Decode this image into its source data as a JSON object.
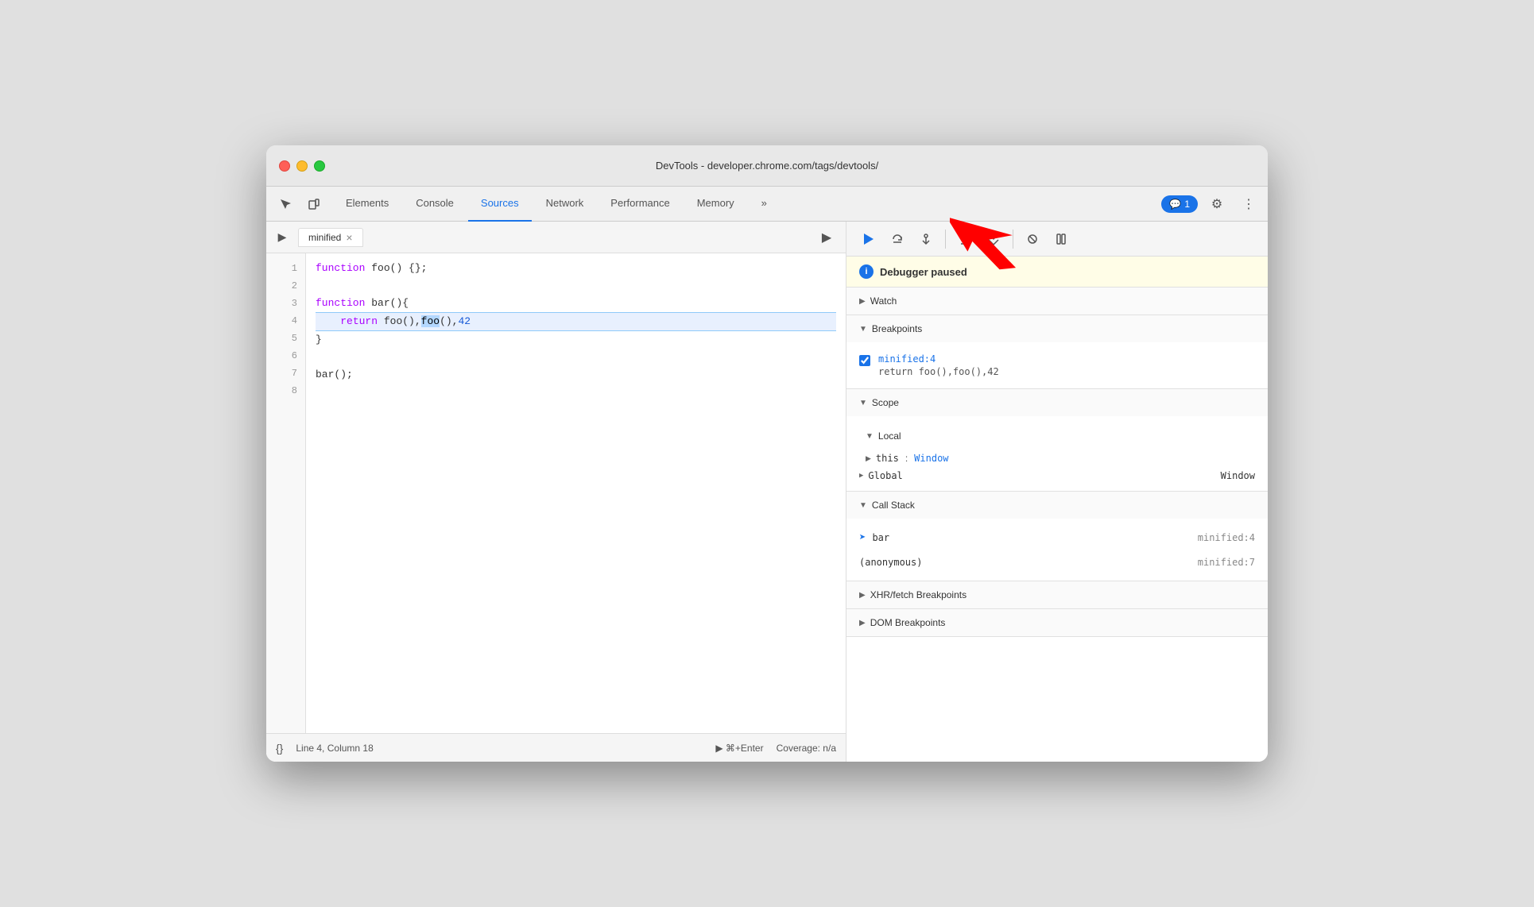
{
  "window": {
    "title": "DevTools - developer.chrome.com/tags/devtools/"
  },
  "toolbar": {
    "tabs": [
      {
        "id": "elements",
        "label": "Elements",
        "active": false
      },
      {
        "id": "console",
        "label": "Console",
        "active": false
      },
      {
        "id": "sources",
        "label": "Sources",
        "active": true
      },
      {
        "id": "network",
        "label": "Network",
        "active": false
      },
      {
        "id": "performance",
        "label": "Performance",
        "active": false
      },
      {
        "id": "memory",
        "label": "Memory",
        "active": false
      },
      {
        "id": "more",
        "label": "»",
        "active": false
      }
    ],
    "badge_label": "1",
    "settings_label": "⚙",
    "more_label": "⋮"
  },
  "sources": {
    "file_tab": "minified",
    "lines": [
      {
        "num": 1,
        "code": "function foo() {};"
      },
      {
        "num": 2,
        "code": ""
      },
      {
        "num": 3,
        "code": "function bar(){"
      },
      {
        "num": 4,
        "code": "    return foo(),foo(),42",
        "highlighted": true
      },
      {
        "num": 5,
        "code": "}"
      },
      {
        "num": 6,
        "code": ""
      },
      {
        "num": 7,
        "code": "bar();"
      },
      {
        "num": 8,
        "code": ""
      }
    ]
  },
  "status_bar": {
    "format_label": "{}",
    "position": "Line 4, Column 18",
    "run_label": "▶ ⌘+Enter",
    "coverage": "Coverage: n/a"
  },
  "debugger": {
    "paused_text": "Debugger paused",
    "watch_label": "Watch",
    "breakpoints_label": "Breakpoints",
    "breakpoint": {
      "location": "minified:4",
      "code": "return foo(),foo(),42"
    },
    "scope_label": "Scope",
    "local_label": "Local",
    "this_label": "this",
    "this_value": "Window",
    "global_label": "Global",
    "global_value": "Window",
    "callstack_label": "Call Stack",
    "callstack": [
      {
        "name": "bar",
        "location": "minified:4",
        "current": true
      },
      {
        "name": "(anonymous)",
        "location": "minified:7",
        "current": false
      }
    ],
    "xhr_label": "XHR/fetch Breakpoints",
    "dom_label": "DOM Breakpoints"
  }
}
